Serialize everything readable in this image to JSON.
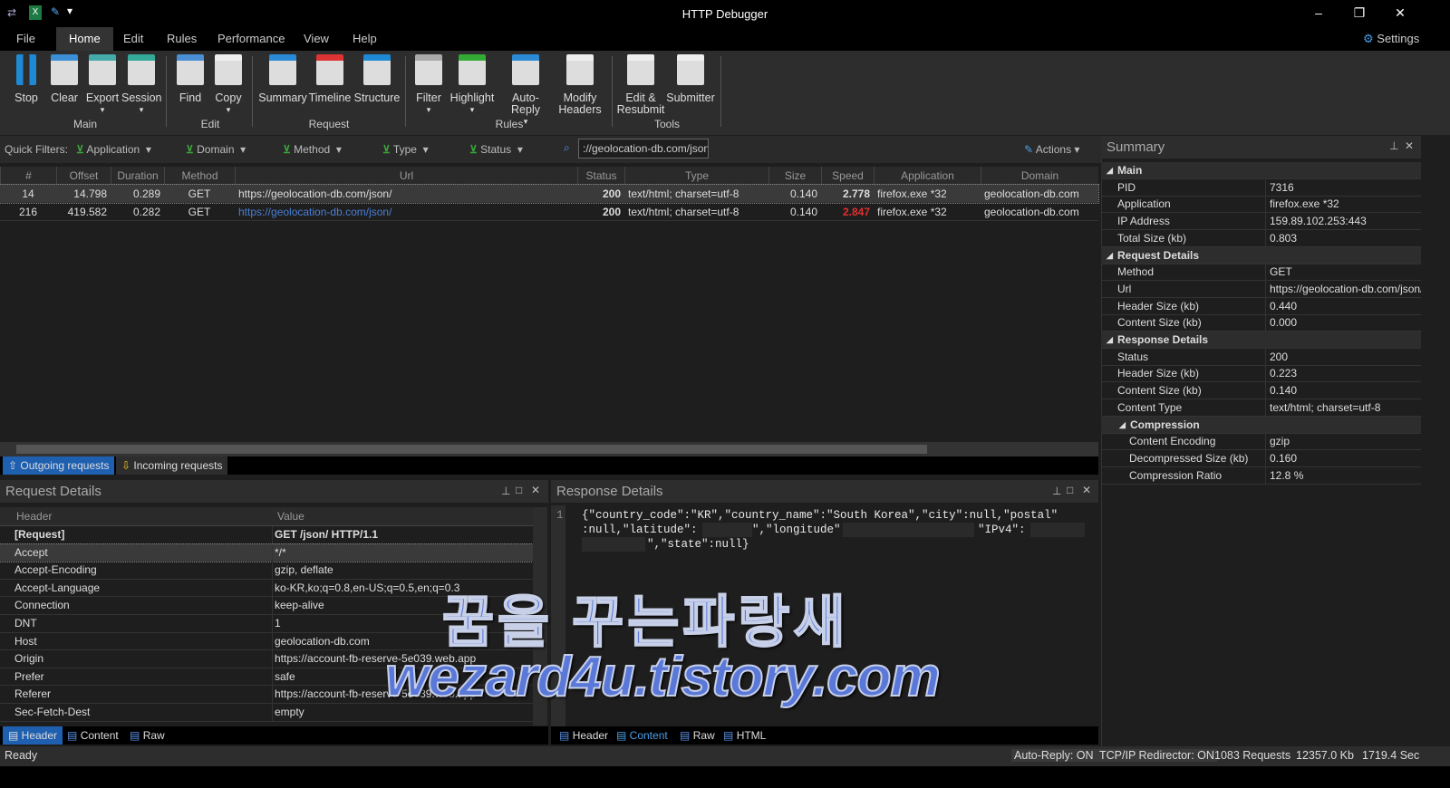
{
  "app": {
    "title": "HTTP Debugger",
    "settings": "Settings"
  },
  "menu": [
    "File",
    "Home",
    "Edit",
    "Rules",
    "Performance",
    "View",
    "Help"
  ],
  "ribbon": {
    "buttons": [
      {
        "label": "Stop",
        "icon": "pause-icon",
        "color": "#1e8ad6"
      },
      {
        "label": "Clear",
        "icon": "broom-icon",
        "color": "#3a8fd6"
      },
      {
        "label": "Export",
        "icon": "export-icon",
        "color": "#4aa"
      },
      {
        "label": "Session",
        "icon": "session-icon",
        "color": "#3a9"
      },
      {
        "label": "Find",
        "icon": "find-icon",
        "color": "#4a8fd6"
      },
      {
        "label": "Copy",
        "icon": "copy-icon",
        "color": "#eee"
      },
      {
        "label": "Summary",
        "icon": "summary-icon",
        "color": "#2a8ad6"
      },
      {
        "label": "Timeline",
        "icon": "timeline-icon",
        "color": "#d33"
      },
      {
        "label": "Structure",
        "icon": "structure-icon",
        "color": "#1e8ad6"
      },
      {
        "label": "Filter",
        "icon": "filter-icon",
        "color": "#aaa"
      },
      {
        "label": "Highlight",
        "icon": "highlight-icon",
        "color": "#3a3"
      },
      {
        "label": "Auto-Reply",
        "icon": "auto-reply-icon",
        "color": "#2a8ad6"
      },
      {
        "label": "Modify Headers",
        "icon": "modify-headers-icon",
        "color": "#eee"
      },
      {
        "label": "Edit & Resubmit",
        "icon": "edit-resubmit-icon",
        "color": "#eee"
      },
      {
        "label": "Submitter",
        "icon": "submitter-icon",
        "color": "#eee"
      }
    ],
    "groups": [
      "Main",
      "Edit",
      "Request",
      "Rules",
      "Tools"
    ]
  },
  "quick_filters": {
    "label": "Quick Filters:",
    "filters": [
      "Application",
      "Domain",
      "Method",
      "Type",
      "Status"
    ],
    "search": "://geolocation-db.com/json/",
    "actions": "Actions"
  },
  "grid": {
    "columns": [
      "#",
      "Offset",
      "Duration",
      "Method",
      "Url",
      "Status",
      "Type",
      "Size",
      "Speed",
      "Application",
      "Domain"
    ],
    "rows": [
      [
        "14",
        "14.798",
        "0.289",
        "GET",
        "https://geolocation-db.com/json/",
        "200",
        "text/html; charset=utf-8",
        "0.140",
        "2.778",
        "firefox.exe *32",
        "geolocation-db.com"
      ],
      [
        "216",
        "419.582",
        "0.282",
        "GET",
        "https://geolocation-db.com/json/",
        "200",
        "text/html; charset=utf-8",
        "0.140",
        "2.847",
        "firefox.exe *32",
        "geolocation-db.com"
      ]
    ],
    "tabs": [
      "Outgoing requests",
      "Incoming requests"
    ]
  },
  "request_details": {
    "title": "Request Details",
    "columns": [
      "Header",
      "Value"
    ],
    "rows": [
      [
        "[Request]",
        "GET /json/ HTTP/1.1"
      ],
      [
        "Accept",
        "*/*"
      ],
      [
        "Accept-Encoding",
        "gzip, deflate"
      ],
      [
        "Accept-Language",
        "ko-KR,ko;q=0.8,en-US;q=0.5,en;q=0.3"
      ],
      [
        "Connection",
        "keep-alive"
      ],
      [
        "DNT",
        "1"
      ],
      [
        "Host",
        "geolocation-db.com"
      ],
      [
        "Origin",
        "https://account-fb-reserve-5e039.web.app"
      ],
      [
        "Prefer",
        "safe"
      ],
      [
        "Referer",
        "https://account-fb-reserve-5e039.web.app"
      ],
      [
        "Sec-Fetch-Dest",
        "empty"
      ]
    ],
    "tabs": [
      "Header",
      "Content",
      "Raw"
    ]
  },
  "response_details": {
    "title": "Response Details",
    "line_no": "1",
    "lines": [
      "{\"country_code\":\"KR\",\"country_name\":\"South Korea\",\"city\":null,\"postal\"",
      ":null,\"latitude\":",
      "\",\"longitude\":",
      "\"IPv4\":",
      "\",\"state\":null}"
    ],
    "tabs": [
      "Header",
      "Content",
      "Raw",
      "HTML"
    ]
  },
  "summary": {
    "title": "Summary",
    "sections": [
      {
        "name": "Main",
        "rows": [
          [
            "PID",
            "7316"
          ],
          [
            "Application",
            "firefox.exe *32"
          ],
          [
            "IP Address",
            "159.89.102.253:443"
          ],
          [
            "Total Size (kb)",
            "0.803"
          ]
        ]
      },
      {
        "name": "Request Details",
        "rows": [
          [
            "Method",
            "GET"
          ],
          [
            "Url",
            "https://geolocation-db.com/json/"
          ],
          [
            "Header Size (kb)",
            "0.440"
          ],
          [
            "Content Size (kb)",
            "0.000"
          ]
        ]
      },
      {
        "name": "Response Details",
        "rows": [
          [
            "Status",
            "200"
          ],
          [
            "Header Size (kb)",
            "0.223"
          ],
          [
            "Content Size (kb)",
            "0.140"
          ],
          [
            "Content Type",
            "text/html; charset=utf-8"
          ]
        ]
      },
      {
        "name": "Compression",
        "rows": [
          [
            "Content Encoding",
            "gzip"
          ],
          [
            "Decompressed Size (kb)",
            "0.160"
          ],
          [
            "Compression Ratio",
            "12.8 %"
          ]
        ]
      }
    ]
  },
  "status": {
    "left": "Ready",
    "auto_reply": "Auto-Reply: ON",
    "redirector": "TCP/IP Redirector: ON",
    "requests": "1083 Requests",
    "size": "12357.0 Kb",
    "time": "1719.4 Sec"
  },
  "watermark": {
    "line1": "꿈을 꾸는파랑새",
    "line2": "wezard4u.tistory.com"
  },
  "colors": {
    "accent": "#1e6fc7",
    "speed_slow": "#e03030",
    "link": "#4a7fd6"
  }
}
